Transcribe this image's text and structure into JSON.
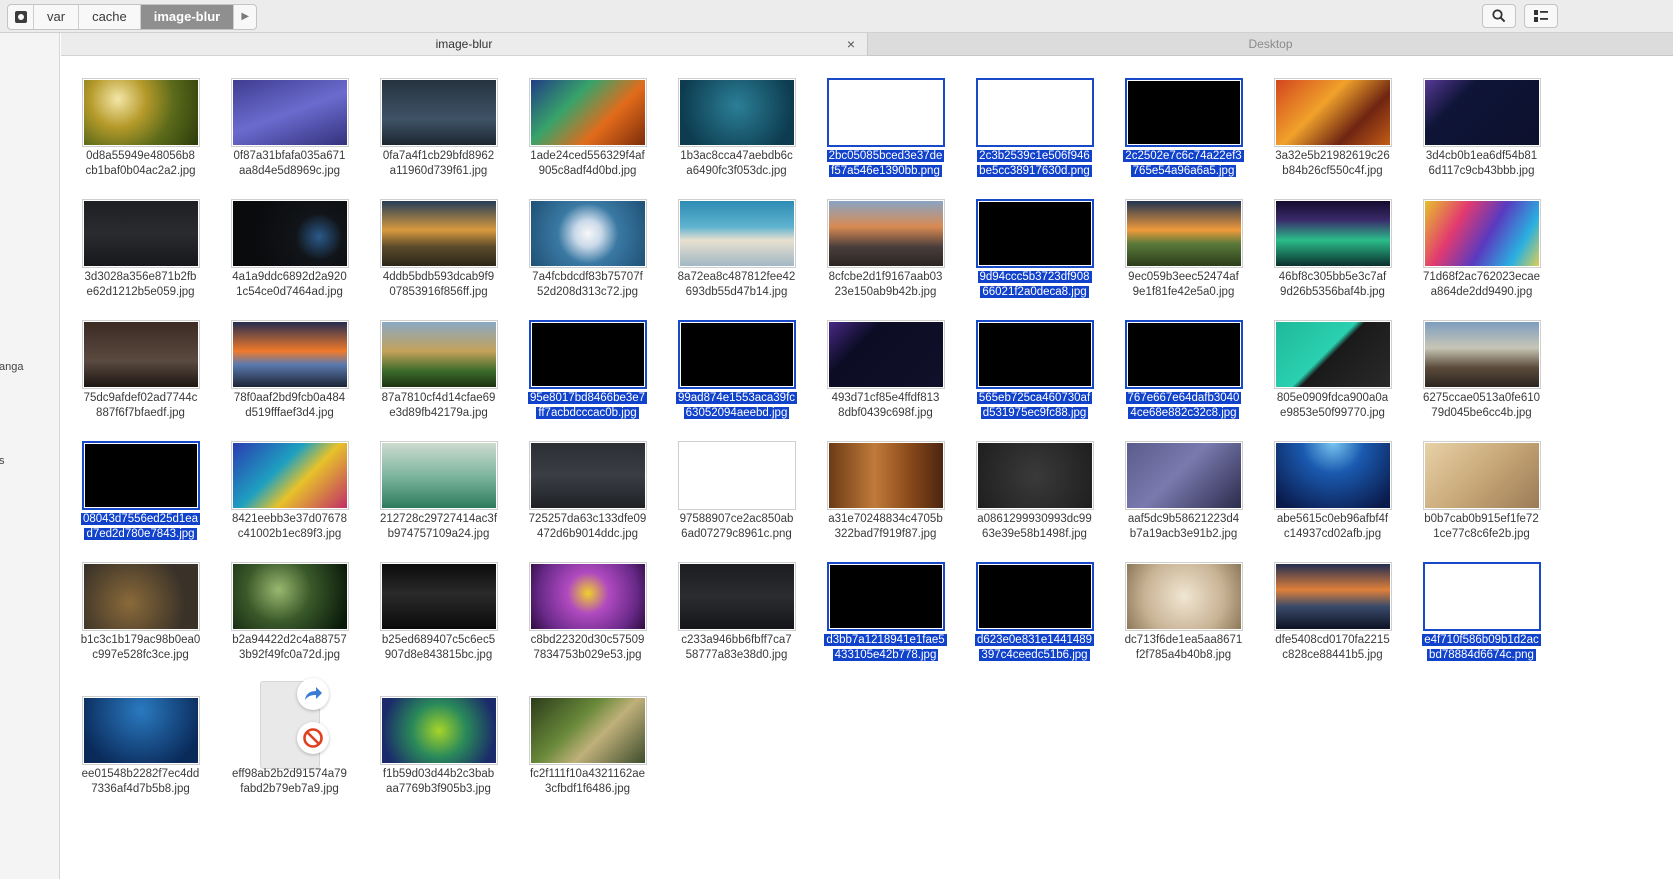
{
  "toolbar": {
    "breadcrumbs": [
      "var",
      "cache",
      "image-blur"
    ],
    "search_icon": "search-icon",
    "view_icon": "view-options-icon"
  },
  "sidebar": {
    "items": [
      "anga",
      "s"
    ]
  },
  "tabs": [
    {
      "label": "image-blur",
      "active": true
    },
    {
      "label": "Desktop",
      "active": false
    }
  ],
  "tab_close": "×",
  "colors": {
    "selection": "#1142cc",
    "toolbar": "#ececec"
  },
  "files": [
    {
      "line1": "0d8a55949e48056b8",
      "line2": "cb1baf0b04ac2a2.jpg",
      "selected": false,
      "look": "mushroom"
    },
    {
      "line1": "0f87a31bfafa035a671",
      "line2": "aa8d4e5d8969c.jpg",
      "selected": false,
      "look": "purple"
    },
    {
      "line1": "0fa7a4f1cb29bfd8962",
      "line2": "a11960d739f61.jpg",
      "selected": false,
      "look": "darkslate"
    },
    {
      "line1": "1ade24ced556329f4af",
      "line2": "905c8adf4d0bd.jpg",
      "selected": false,
      "look": "rainbow"
    },
    {
      "line1": "1b3ac8cca47aebdb6c",
      "line2": "a6490fc3f053dc.jpg",
      "selected": false,
      "look": "teal"
    },
    {
      "line1": "2bc05085bced3e37de",
      "line2": "f57a546e1390bb.png",
      "selected": true,
      "look": "white"
    },
    {
      "line1": "2c3b2539c1e506f946",
      "line2": "be5cc38917630d.png",
      "selected": true,
      "look": "white"
    },
    {
      "line1": "2c2502e7c6c74a22ef3",
      "line2": "765e54a96a6a5.jpg",
      "selected": true,
      "look": "black"
    },
    {
      "line1": "3a32e5b21982619c26",
      "line2": "b84b26cf550c4f.jpg",
      "selected": false,
      "look": "leaves"
    },
    {
      "line1": "3d4cb0b1ea6df54b81",
      "line2": "6d117c9cb43bbb.jpg",
      "selected": false,
      "look": "navy"
    },
    {
      "line1": "3d3028a356e871b2fb",
      "line2": "e62d1212b5e059.jpg",
      "selected": false,
      "look": "charcoal"
    },
    {
      "line1": "4a1a9ddc6892d2a920",
      "line2": "1c54ce0d7464ad.jpg",
      "selected": false,
      "look": "darkblue-dot"
    },
    {
      "line1": "4ddb5bdb593dcab9f9",
      "line2": "07853916f856ff.jpg",
      "selected": false,
      "look": "clouds"
    },
    {
      "line1": "7a4fcbdcdf83b75707f",
      "line2": "52d208d313c72.jpg",
      "selected": false,
      "look": "swirl"
    },
    {
      "line1": "8a72ea8c487812fee42",
      "line2": "693db55d47b14.jpg",
      "selected": false,
      "look": "building"
    },
    {
      "line1": "8cfcbe2d1f9167aab03",
      "line2": "23e150ab9b42b.jpg",
      "selected": false,
      "look": "mountain"
    },
    {
      "line1": "9d94ccc5b3723df908",
      "line2": "66021f2a0deca8.jpg",
      "selected": true,
      "look": "black"
    },
    {
      "line1": "9ec059b3eec52474af",
      "line2": "9e1f81fe42e5a0.jpg",
      "selected": false,
      "look": "landscape"
    },
    {
      "line1": "46bf8c305bb5e3c7af",
      "line2": "9d26b5356baf4b.jpg",
      "selected": false,
      "look": "aurora"
    },
    {
      "line1": "71d68f2ac762023ecae",
      "line2": "a864de2dd9490.jpg",
      "selected": false,
      "look": "bands"
    },
    {
      "line1": "75dc9afdef02ad7744c",
      "line2": "887f6f7bfaedf.jpg",
      "selected": false,
      "look": "brown"
    },
    {
      "line1": "78f0aaf2bd9fcb0a484",
      "line2": "d519fffaef3d4.jpg",
      "selected": false,
      "look": "sunset"
    },
    {
      "line1": "87a7810cf4d14cfae69",
      "line2": "e3d89fb42179a.jpg",
      "selected": false,
      "look": "grass"
    },
    {
      "line1": "95e8017bd8466be3e7",
      "line2": "ff7acbdcccac0b.jpg",
      "selected": true,
      "look": "black"
    },
    {
      "line1": "99ad874e1553aca39fc",
      "line2": "63052094aeebd.jpg",
      "selected": true,
      "look": "black"
    },
    {
      "line1": "493d71cf85e4ffdf813",
      "line2": "8dbf0439c698f.jpg",
      "selected": false,
      "look": "navyprism"
    },
    {
      "line1": "565eb725ca460730af",
      "line2": "d531975ec9fc88.jpg",
      "selected": true,
      "look": "black"
    },
    {
      "line1": "767e667e64dafb3040",
      "line2": "4ce68e882c32c8.jpg",
      "selected": true,
      "look": "black"
    },
    {
      "line1": "805e0909fdca900a0a",
      "line2": "e9853e50f99770.jpg",
      "selected": false,
      "look": "greenarc"
    },
    {
      "line1": "6275ccae0513a0fe610",
      "line2": "79d045be6cc4b.jpg",
      "selected": false,
      "look": "desk"
    },
    {
      "line1": "08043d7556ed25d1ea",
      "line2": "d7ed2d780e7843.jpg",
      "selected": true,
      "look": "black"
    },
    {
      "line1": "8421eebb3e37d07678",
      "line2": "c41002b1ec89f3.jpg",
      "selected": false,
      "look": "fish"
    },
    {
      "line1": "212728c29727414ac3f",
      "line2": "b974757109a24.jpg",
      "selected": false,
      "look": "green-towers"
    },
    {
      "line1": "725257da63c133dfe09",
      "line2": "472d6b9014ddc.jpg",
      "selected": false,
      "look": "graystrip"
    },
    {
      "line1": "97588907ce2ac850ab",
      "line2": "6ad07279c8961c.png",
      "selected": false,
      "look": "white"
    },
    {
      "line1": "a31e70248834c4705b",
      "line2": "322bad7f919f87.jpg",
      "selected": false,
      "look": "wood"
    },
    {
      "line1": "a0861299930993dc99",
      "line2": "63e39e58b1498f.jpg",
      "selected": false,
      "look": "darkgray"
    },
    {
      "line1": "aaf5dc9b58621223d4",
      "line2": "b7a19acb3e91b2.jpg",
      "selected": false,
      "look": "lavender"
    },
    {
      "line1": "abe5615c0eb96afbf4f",
      "line2": "c14937cd02afb.jpg",
      "selected": false,
      "look": "deepblue"
    },
    {
      "line1": "b0b7cab0b915ef1fe72",
      "line2": "1ce77c8c6fe2b.jpg",
      "selected": false,
      "look": "sand"
    },
    {
      "line1": "b1c3c1b179ac98b0ea0",
      "line2": "c997e528fc3ce.jpg",
      "selected": false,
      "look": "bokeh"
    },
    {
      "line1": "b2a94422d2c4a88757",
      "line2": "3b92f49fc0a72d.jpg",
      "selected": false,
      "look": "drop"
    },
    {
      "line1": "b25ed689407c5c6ec5",
      "line2": "907d8e843815bc.jpg",
      "selected": false,
      "look": "rays"
    },
    {
      "line1": "c8bd22320d30c57509",
      "line2": "7834753b029e53.jpg",
      "selected": false,
      "look": "flower"
    },
    {
      "line1": "c233a946bb6fbff7ca7",
      "line2": "58777a83e38d0.jpg",
      "selected": false,
      "look": "dark-lines"
    },
    {
      "line1": "d3bb7a1218941e1fae5",
      "line2": "433105e42b778.jpg",
      "selected": true,
      "look": "black"
    },
    {
      "line1": "d623e0e831e1441489",
      "line2": "397c4ceedc51b6.jpg",
      "selected": true,
      "look": "black"
    },
    {
      "line1": "dc713f6de1ea5aa8671",
      "line2": "f2f785a4b40b8.jpg",
      "selected": false,
      "look": "mesh"
    },
    {
      "line1": "dfe5408cd0170fa2215",
      "line2": "c828ce88441b5.jpg",
      "selected": false,
      "look": "horizon"
    },
    {
      "line1": "e4f710f586b09b1d2ac",
      "line2": "bd78884d6674c.png",
      "selected": true,
      "look": "white"
    },
    {
      "line1": "ee01548b2282f7ec4dd",
      "line2": "7336af4d7b5b8.jpg",
      "selected": false,
      "look": "ocean"
    },
    {
      "line1": "eff98ab2b2d91574a79",
      "line2": "fabd2b79eb7a9.jpg",
      "selected": false,
      "look": "doc"
    },
    {
      "line1": "f1b59d03d44b2c3bab",
      "line2": "aa7769b3f905b3.jpg",
      "selected": false,
      "look": "bird"
    },
    {
      "line1": "fc2f111f10a4321162ae",
      "line2": "3cfbdf1f6486.jpg",
      "selected": false,
      "look": "terrain"
    }
  ]
}
